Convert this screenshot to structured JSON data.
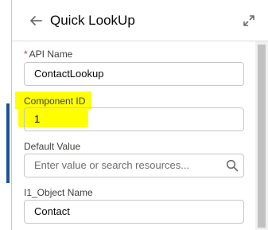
{
  "panel": {
    "title": "Quick LookUp"
  },
  "fields": {
    "api_name": {
      "required_marker": "*",
      "label": "API Name",
      "value": "ContactLookup"
    },
    "component_id": {
      "label": "Component ID",
      "value": "1"
    },
    "default_value": {
      "label": "Default Value",
      "placeholder": "Enter value or search resources..."
    },
    "object_name": {
      "label": "I1_Object Name",
      "value": "Contact"
    }
  },
  "icons": {
    "back": "arrow-left-icon",
    "expand": "expand-icon",
    "search": "search-icon"
  },
  "colors": {
    "highlight": "#ffff00",
    "required": "#c23934",
    "border": "#c9c7c5"
  }
}
